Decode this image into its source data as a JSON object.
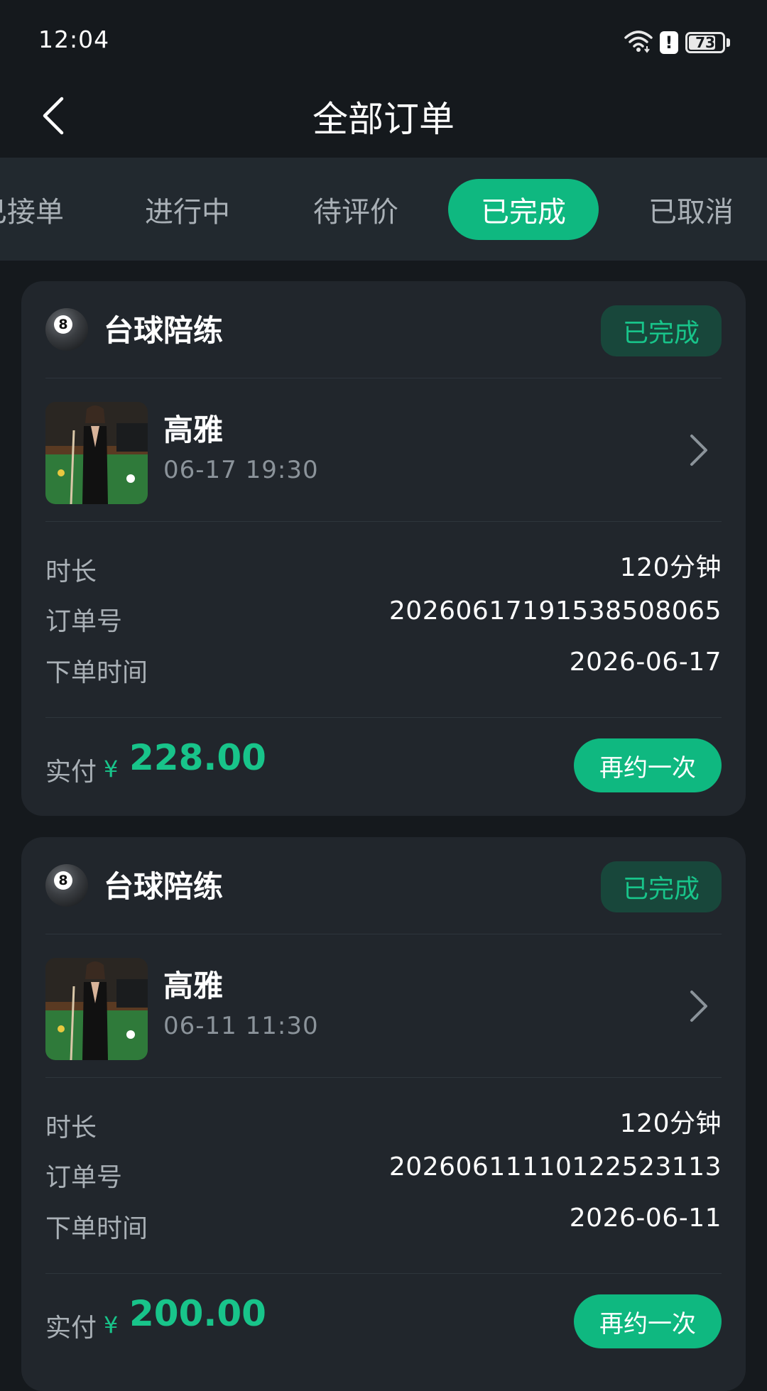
{
  "status_bar": {
    "time": "12:04",
    "battery_level": "73",
    "battery_fraction": 0.73,
    "icons": [
      "wifi-icon",
      "alert-icon",
      "battery-icon"
    ]
  },
  "header": {
    "title": "全部订单",
    "back_icon": "chevron-left-icon"
  },
  "tabs": [
    {
      "label": "已接单",
      "active": false
    },
    {
      "label": "进行中",
      "active": false
    },
    {
      "label": "待评价",
      "active": false
    },
    {
      "label": "已完成",
      "active": true
    },
    {
      "label": "已取消",
      "active": false
    }
  ],
  "colors": {
    "accent": "#0fb880",
    "accent_text": "#18c48a",
    "background": "#15191d",
    "card": "#21262c"
  },
  "orders": [
    {
      "service": "台球陪练",
      "service_icon": "billiard-ball-icon",
      "ball_number": "8",
      "status": "已完成",
      "companion_name": "高雅",
      "appointment_time": "06-17 19:30",
      "details": [
        {
          "label": "时长",
          "value": "120分钟"
        },
        {
          "label": "订单号",
          "value": "20260617191538508065"
        },
        {
          "label": "下单时间",
          "value": "2026-06-17"
        }
      ],
      "paid_label": "实付",
      "currency": "¥",
      "amount": "228.00",
      "action_label": "再约一次"
    },
    {
      "service": "台球陪练",
      "service_icon": "billiard-ball-icon",
      "ball_number": "8",
      "status": "已完成",
      "companion_name": "高雅",
      "appointment_time": "06-11 11:30",
      "details": [
        {
          "label": "时长",
          "value": "120分钟"
        },
        {
          "label": "订单号",
          "value": "20260611110122523113"
        },
        {
          "label": "下单时间",
          "value": "2026-06-11"
        }
      ],
      "paid_label": "实付",
      "currency": "¥",
      "amount": "200.00",
      "action_label": "再约一次"
    }
  ]
}
